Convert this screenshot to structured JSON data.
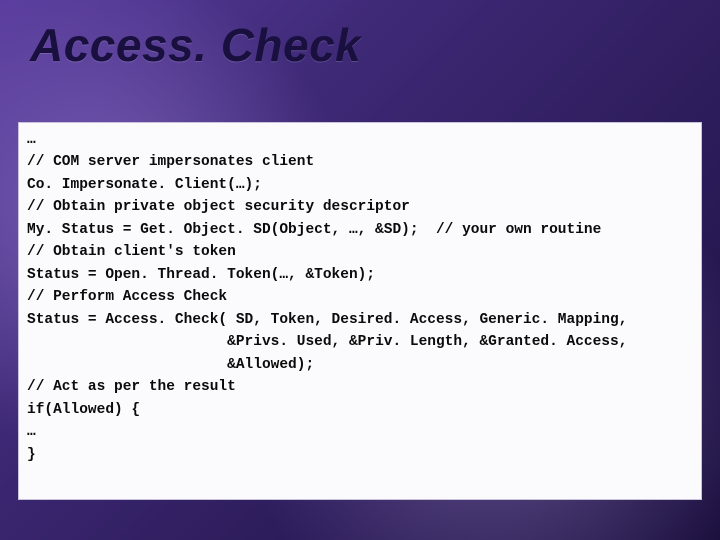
{
  "title": "Access. Check",
  "code_lines": [
    "…",
    "// COM server impersonates client",
    "Co. Impersonate. Client(…);",
    "// Obtain private object security descriptor",
    "My. Status = Get. Object. SD(Object, …, &SD);  // your own routine",
    "// Obtain client's token",
    "Status = Open. Thread. Token(…, &Token);",
    "// Perform Access Check",
    "Status = Access. Check( SD, Token, Desired. Access, Generic. Mapping,",
    "                       &Privs. Used, &Priv. Length, &Granted. Access,",
    "                       &Allowed);",
    "// Act as per the result",
    "if(Allowed) {",
    "…",
    "}"
  ]
}
